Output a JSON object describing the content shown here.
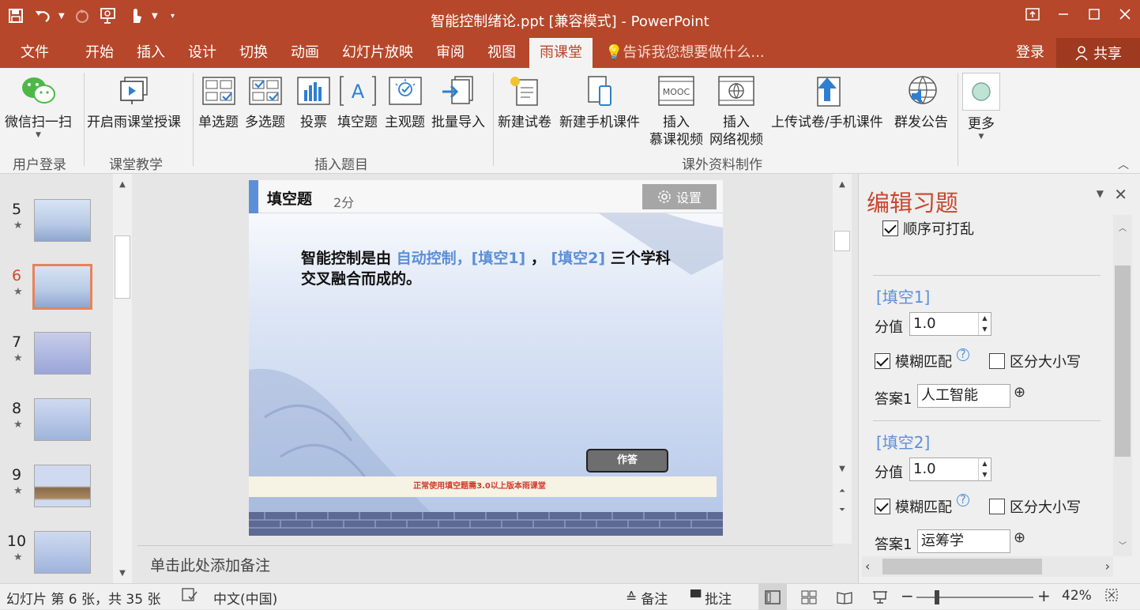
{
  "window": {
    "title": "智能控制绪论.ppt [兼容模式] - PowerPoint"
  },
  "tabs": {
    "file": "文件",
    "home": "开始",
    "insert": "插入",
    "design": "设计",
    "transitions": "切换",
    "animations": "动画",
    "slideshow": "幻灯片放映",
    "review": "审阅",
    "view": "视图",
    "rain": "雨课堂",
    "tellme": "告诉我您想要做什么...",
    "signin": "登录",
    "share": "共享"
  },
  "ribbon": {
    "wechat_scan": "微信扫一扫",
    "group_login": "用户登录",
    "start_teaching": "开启雨课堂授课",
    "group_teaching": "课堂教学",
    "single_choice": "单选题",
    "multi_choice": "多选题",
    "vote": "投票",
    "fill_blank": "填空题",
    "subjective": "主观题",
    "batch_import": "批量导入",
    "group_insert": "插入题目",
    "new_test": "新建试卷",
    "new_mobile": "新建手机课件",
    "mooc_1": "插入",
    "mooc_2": "慕课视频",
    "web_1": "插入",
    "web_2": "网络视频",
    "upload": "上传试卷/手机课件",
    "announce": "群发公告",
    "group_extra": "课外资料制作",
    "more": "更多",
    "mooc_icon_text": "MOOC"
  },
  "thumbnails": [
    {
      "num": "5"
    },
    {
      "num": "6"
    },
    {
      "num": "7"
    },
    {
      "num": "8"
    },
    {
      "num": "9"
    },
    {
      "num": "10"
    }
  ],
  "slide": {
    "type": "填空题",
    "score": "2分",
    "settings": "设置",
    "q_prefix": "智能控制是由",
    "q_blue1": "自动控制，[填空1]",
    "q_comma": "，",
    "q_blue2": "[填空2]",
    "q_suffix": "三个学科交叉融合而成的。",
    "answer_button": "作答",
    "note": "正常使用填空题需3.0以上版本雨课堂"
  },
  "notes_placeholder": "单击此处添加备注",
  "pane": {
    "title": "编辑习题",
    "shuffle": "顺序可打乱",
    "blank1": {
      "header": "[填空1]",
      "score_label": "分值",
      "score": "1.0",
      "fuzzy": "模糊匹配",
      "case": "区分大小写",
      "answer_label": "答案1",
      "answer": "人工智能"
    },
    "blank2": {
      "header": "[填空2]",
      "score_label": "分值",
      "score": "1.0",
      "fuzzy": "模糊匹配",
      "case": "区分大小写",
      "answer_label": "答案1",
      "answer": "运筹学"
    }
  },
  "status": {
    "slide_info": "幻灯片 第 6 张，共 35 张",
    "language": "中文(中国)",
    "notes": "备注",
    "comments": "批注",
    "zoom": "42%",
    "zoom_level": 0.42
  },
  "colors": {
    "accent": "#b7472a",
    "blue": "#5b8fd9",
    "pane_title": "#c9472d"
  }
}
